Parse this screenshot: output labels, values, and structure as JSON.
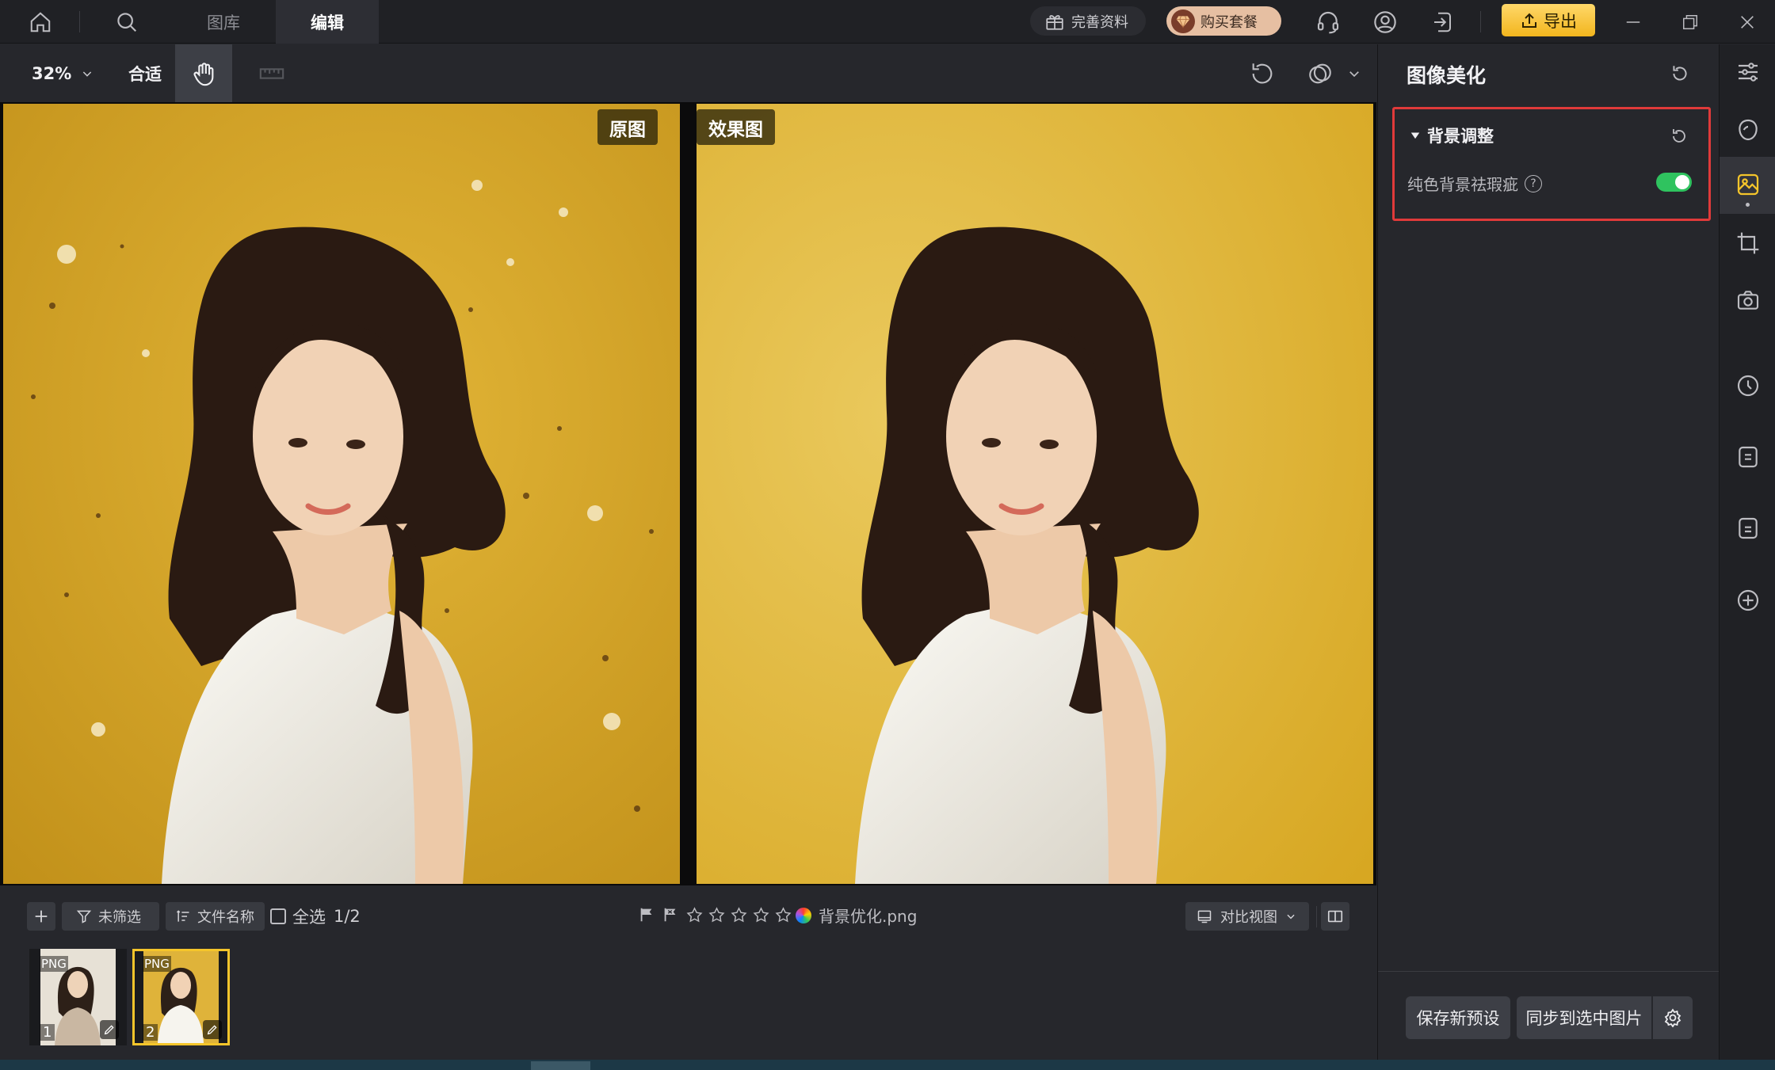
{
  "topbar": {
    "tabs": [
      {
        "label": "图库"
      },
      {
        "label": "编辑"
      }
    ],
    "profile_button": "完善资料",
    "buy_button": "购买套餐",
    "export_button": "导出"
  },
  "toolbar": {
    "zoom_value": "32%",
    "fit_label": "合适"
  },
  "canvas": {
    "original_tag": "原图",
    "result_tag": "效果图"
  },
  "filterbar": {
    "filter_label": "未筛选",
    "sort_label": "文件名称",
    "select_all_label": "全选",
    "selection_count": "1/2",
    "rating_stars": 0,
    "file_name": "背景优化.png",
    "view_mode": "对比视图"
  },
  "thumbnails": [
    {
      "badge": "PNG",
      "index": "1"
    },
    {
      "badge": "PNG",
      "index": "2"
    }
  ],
  "panel": {
    "title": "图像美化",
    "section_title": "背景调整",
    "toggle_label": "纯色背景祛瑕疵",
    "toggle_on": true,
    "save_preset_button": "保存新预设",
    "sync_button": "同步到选中图片"
  },
  "colors": {
    "accent_yellow": "#f5c52b",
    "toggle_green": "#2fc35f",
    "highlight_red": "#e03a3a"
  }
}
